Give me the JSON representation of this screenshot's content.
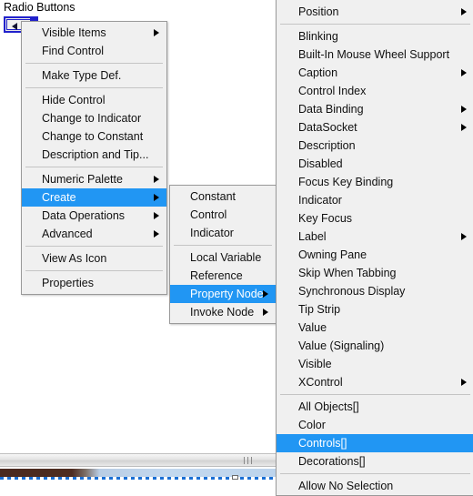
{
  "panel": {
    "title": "Radio Buttons",
    "control_icon": "radio-button-control-icon"
  },
  "context_menu": {
    "name": "control-right-click-menu",
    "items": [
      {
        "label": "Visible Items",
        "submenu": true
      },
      {
        "label": "Find Control",
        "submenu": false
      },
      {
        "separator": true
      },
      {
        "label": "Make Type Def.",
        "submenu": false
      },
      {
        "separator": true
      },
      {
        "label": "Hide Control",
        "submenu": false
      },
      {
        "label": "Change to Indicator",
        "submenu": false
      },
      {
        "label": "Change to Constant",
        "submenu": false
      },
      {
        "label": "Description and Tip...",
        "submenu": false
      },
      {
        "separator": true
      },
      {
        "label": "Numeric Palette",
        "submenu": true
      },
      {
        "label": "Create",
        "submenu": true,
        "selected": true
      },
      {
        "label": "Data Operations",
        "submenu": true
      },
      {
        "label": "Advanced",
        "submenu": true
      },
      {
        "separator": true
      },
      {
        "label": "View As Icon",
        "submenu": false
      },
      {
        "separator": true
      },
      {
        "label": "Properties",
        "submenu": false
      }
    ]
  },
  "create_menu": {
    "name": "create-submenu",
    "items": [
      {
        "label": "Constant",
        "submenu": false
      },
      {
        "label": "Control",
        "submenu": false
      },
      {
        "label": "Indicator",
        "submenu": false
      },
      {
        "separator": true
      },
      {
        "label": "Local Variable",
        "submenu": false
      },
      {
        "label": "Reference",
        "submenu": false
      },
      {
        "label": "Property Node",
        "submenu": true,
        "selected": true
      },
      {
        "label": "Invoke Node",
        "submenu": true
      }
    ]
  },
  "property_menu": {
    "name": "property-node-submenu",
    "items": [
      {
        "label": "Position",
        "submenu": true
      },
      {
        "separator": true
      },
      {
        "label": "Blinking",
        "submenu": false
      },
      {
        "label": "Built-In Mouse Wheel Support",
        "submenu": false
      },
      {
        "label": "Caption",
        "submenu": true
      },
      {
        "label": "Control Index",
        "submenu": false
      },
      {
        "label": "Data Binding",
        "submenu": true
      },
      {
        "label": "DataSocket",
        "submenu": true
      },
      {
        "label": "Description",
        "submenu": false
      },
      {
        "label": "Disabled",
        "submenu": false
      },
      {
        "label": "Focus Key Binding",
        "submenu": false
      },
      {
        "label": "Indicator",
        "submenu": false
      },
      {
        "label": "Key Focus",
        "submenu": false
      },
      {
        "label": "Label",
        "submenu": true
      },
      {
        "label": "Owning Pane",
        "submenu": false
      },
      {
        "label": "Skip When Tabbing",
        "submenu": false
      },
      {
        "label": "Synchronous Display",
        "submenu": false
      },
      {
        "label": "Tip Strip",
        "submenu": false
      },
      {
        "label": "Value",
        "submenu": false
      },
      {
        "label": "Value (Signaling)",
        "submenu": false
      },
      {
        "label": "Visible",
        "submenu": false
      },
      {
        "label": "XControl",
        "submenu": true
      },
      {
        "separator": true
      },
      {
        "label": "All Objects[]",
        "submenu": false
      },
      {
        "label": "Color",
        "submenu": false
      },
      {
        "label": "Controls[]",
        "submenu": false,
        "selected": true
      },
      {
        "label": "Decorations[]",
        "submenu": false
      },
      {
        "separator": true
      },
      {
        "label": "Allow No Selection",
        "submenu": false
      }
    ]
  },
  "colors": {
    "menu_background": "#f0f0f0",
    "menu_border": "#9a9a9a",
    "highlight": "#2196f3",
    "highlight_text": "#ffffff",
    "text": "#101010",
    "control_border": "#2222cc",
    "dashed_edge": "#1a6fd4"
  }
}
